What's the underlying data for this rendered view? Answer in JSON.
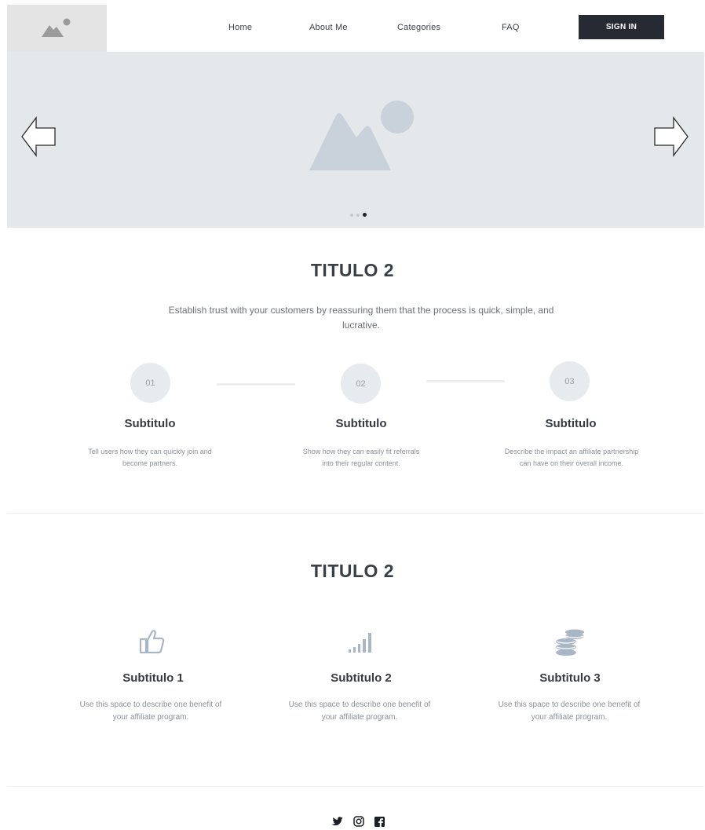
{
  "header": {
    "nav": [
      {
        "label": "Home"
      },
      {
        "label": "About Me"
      },
      {
        "label": "Categories"
      },
      {
        "label": "FAQ"
      }
    ],
    "signin_label": "SIGN IN"
  },
  "hero": {
    "slide_count": 3,
    "active_slide": 3
  },
  "steps_section": {
    "title": "TITULO 2",
    "lead": "Establish trust with your customers by reassuring them that the process is quick, simple, and lucrative.",
    "steps": [
      {
        "number": "01",
        "title": "Subtitulo",
        "desc": "Tell users how they can quickly join and become partners."
      },
      {
        "number": "02",
        "title": "Subtitulo",
        "desc": "Show how they can easily fit referrals into their regular content."
      },
      {
        "number": "03",
        "title": "Subtitulo",
        "desc": "Describe the impact an affiliate partnership can have on their overall income."
      }
    ]
  },
  "benefits_section": {
    "title": "TITULO 2",
    "items": [
      {
        "icon": "thumbs-up-icon",
        "title": "Subtitulo 1",
        "desc": "Use this space to describe one benefit of your affiliate program."
      },
      {
        "icon": "signal-bars-icon",
        "title": "Subtitulo 2",
        "desc": "Use this space to describe one benefit of your affiliate program."
      },
      {
        "icon": "coins-icon",
        "title": "Subtitulo 3",
        "desc": "Use this space to describe one benefit of your affiliate program."
      }
    ]
  },
  "footer": {
    "social": [
      "twitter-icon",
      "instagram-icon",
      "facebook-icon"
    ]
  },
  "colors": {
    "hero_bg": "#e5e8eb",
    "signin_bg": "#262b33",
    "icon_gray": "#c3ccd6",
    "icon_blue_gray": "#a9b6c6"
  }
}
